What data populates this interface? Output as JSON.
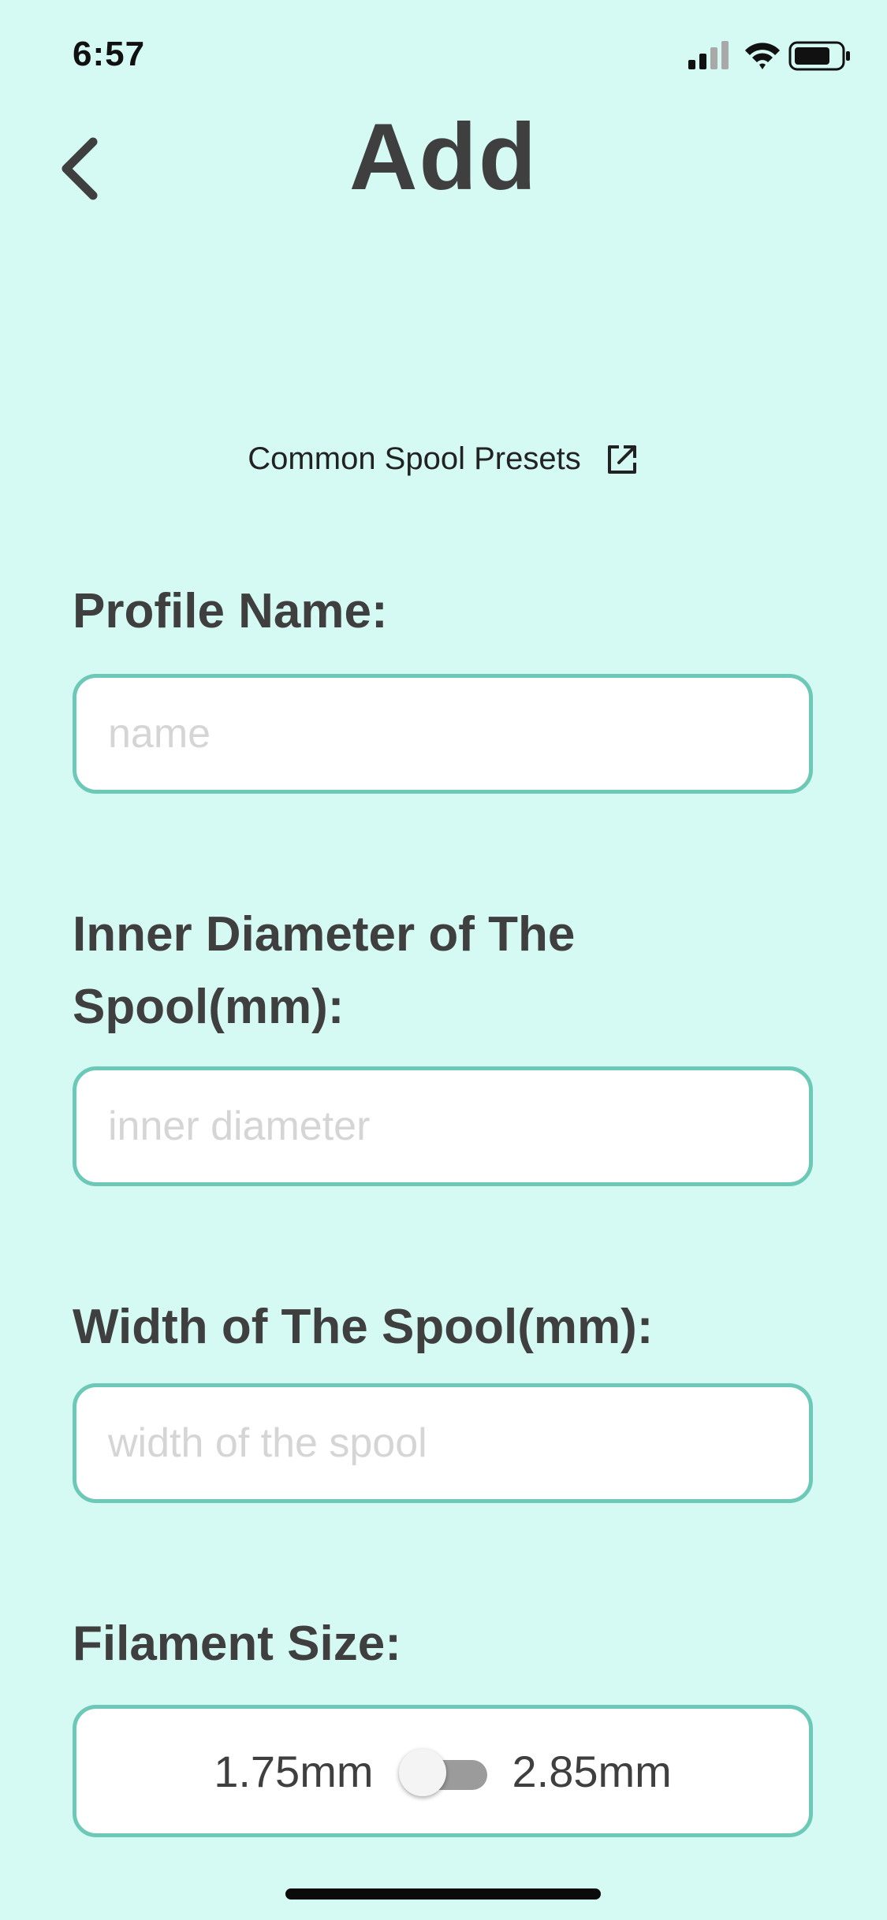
{
  "status_bar": {
    "time": "6:57",
    "icons": [
      "signal-icon",
      "wifi-icon",
      "battery-icon"
    ]
  },
  "header": {
    "back_icon": "chevron-left-icon",
    "title": "Add"
  },
  "presets": {
    "label": "Common Spool Presets",
    "icon": "external-link-icon"
  },
  "form": {
    "profile_name": {
      "label": "Profile Name:",
      "placeholder": "name",
      "value": ""
    },
    "inner_diameter": {
      "label": "Inner Diameter of The Spool(mm):",
      "placeholder": "inner diameter",
      "value": ""
    },
    "width": {
      "label": "Width of The Spool(mm):",
      "placeholder": "width of the spool",
      "value": ""
    },
    "filament_size": {
      "label": "Filament Size:",
      "option_left": "1.75mm",
      "option_right": "2.85mm",
      "selected": "1.75mm"
    }
  },
  "colors": {
    "background": "#d5f9f3",
    "field_border": "#6cc8b7",
    "text": "#3f3f3f",
    "placeholder": "#d5d5d5"
  }
}
